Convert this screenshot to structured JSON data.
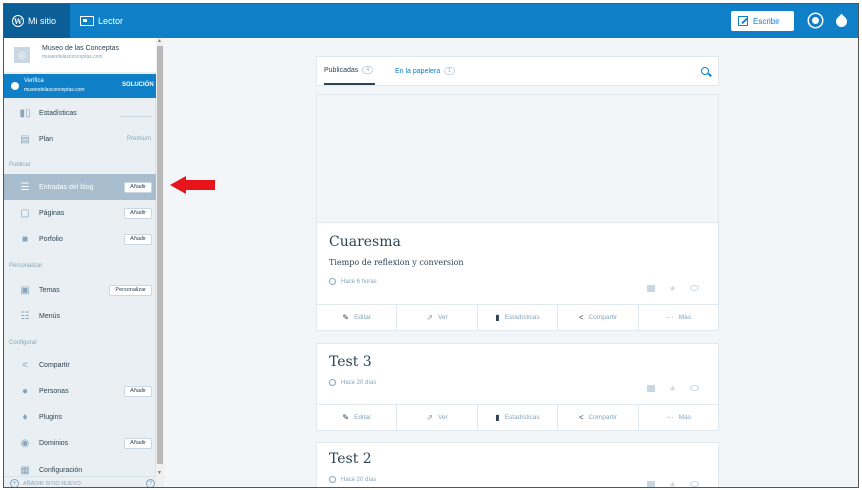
{
  "topbar": {
    "my_site": "Mi sitio",
    "reader": "Lector",
    "write": "Escribir",
    "accent": "#0f7fc8"
  },
  "sidebar": {
    "site_name": "Museo de las Conceptas",
    "site_url": "museodelasconceptas.com",
    "verify_label": "Verifica",
    "verify_url": "museodelasconceptas.com",
    "verify_action": "SOLUCIÓN",
    "stats": "Estadísticas",
    "plan": "Plan",
    "plan_value": "Premium",
    "section_publish": "Publicar",
    "blog_posts": "Entradas del blog",
    "pages": "Páginas",
    "portfolio": "Porfolio",
    "add": "Añadir",
    "section_personalize": "Personalizar",
    "themes": "Temas",
    "personalize_btn": "Personalizar",
    "menus": "Menús",
    "section_configure": "Configurar",
    "share": "Compartir",
    "people": "Personas",
    "plugins": "Plugins",
    "domains": "Dominios",
    "settings": "Configuración",
    "add_new_site": "AÑADIR SITIO NUEVO"
  },
  "tabs": {
    "published": "Publicadas",
    "published_count": "4",
    "trash": "En la papelera",
    "trash_count": "1"
  },
  "posts": [
    {
      "title": "Cuaresma",
      "excerpt": "Tiempo de reflexion y conversion",
      "time": "Hace 6 horas"
    },
    {
      "title": "Test 3",
      "time": "Hace 20 días"
    },
    {
      "title": "Test 2",
      "time": "Hace 20 días"
    }
  ],
  "actions": {
    "edit": "Editar",
    "view": "Ver",
    "stats": "Estadísticas",
    "share": "Compartir",
    "more": "Más"
  },
  "annotation_color": "#e8141b"
}
